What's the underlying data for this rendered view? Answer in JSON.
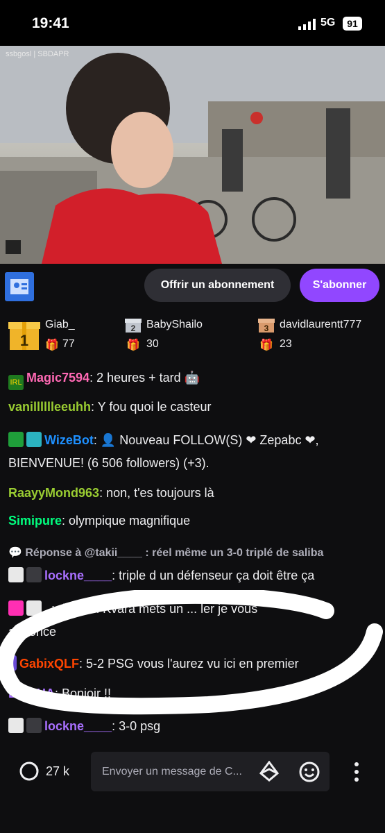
{
  "status_bar": {
    "time": "19:41",
    "network": "5G",
    "battery": "91"
  },
  "video": {
    "overlay_text": "ssbgosl | SBDAPR"
  },
  "actions": {
    "gift_label": "Offrir un abonnement",
    "subscribe_label": "S'abonner"
  },
  "leaderboard": [
    {
      "rank": "1",
      "name": "Giab_",
      "count": "77"
    },
    {
      "rank": "2",
      "name": "BabyShailo",
      "count": "30"
    },
    {
      "rank": "3",
      "name": "davidlaurentt777",
      "count": "23"
    }
  ],
  "chat": [
    {
      "user": "Magic7594",
      "user_color": "#ff69b4",
      "text": "2 heures + tard",
      "badge": "IRL"
    },
    {
      "user": "vanilllllleeuhh",
      "user_color": "#9acd32",
      "text": "Y fou quoi le casteur"
    },
    {
      "user": "WizeBot",
      "user_color": "#1e90ff",
      "text": "👤 Nouveau FOLLOW(S) ❤ Zepabc ❤,",
      "text2": "BIENVENUE! (6 506 followers) (+3)."
    },
    {
      "user": "RaayyMond963",
      "user_color": "#9acd32",
      "text": "non, t'es toujours là"
    },
    {
      "user": "Simipure",
      "user_color": "#00ff7f",
      "text": "olympique magnifique"
    },
    {
      "reply": "Réponse à @takii____ : réel même un 3-0 triplé de saliba"
    },
    {
      "user": "lockne____",
      "user_color": "#a970ff",
      "text": "triple d un défenseur ça doit être ça"
    },
    {
      "user": "_",
      "user_color": "#ff4500",
      "text": "demain Kvara mets un ... ler je vous",
      "text2": "annonce"
    },
    {
      "user": "GabixQLF",
      "user_color": "#ff4500",
      "text": "5-2 PSG vous l'aurez vu ici en premier"
    },
    {
      "user": "DUMHA",
      "user_color": "#a970ff",
      "text": "Bonjoir !!"
    },
    {
      "user": "lockne____",
      "user_color": "#a970ff",
      "text": "3-0 psg"
    }
  ],
  "bottom": {
    "viewers": "27 k",
    "placeholder": "Envoyer un message de C..."
  },
  "colors": {
    "accent": "#9147ff",
    "background": "#000000"
  }
}
